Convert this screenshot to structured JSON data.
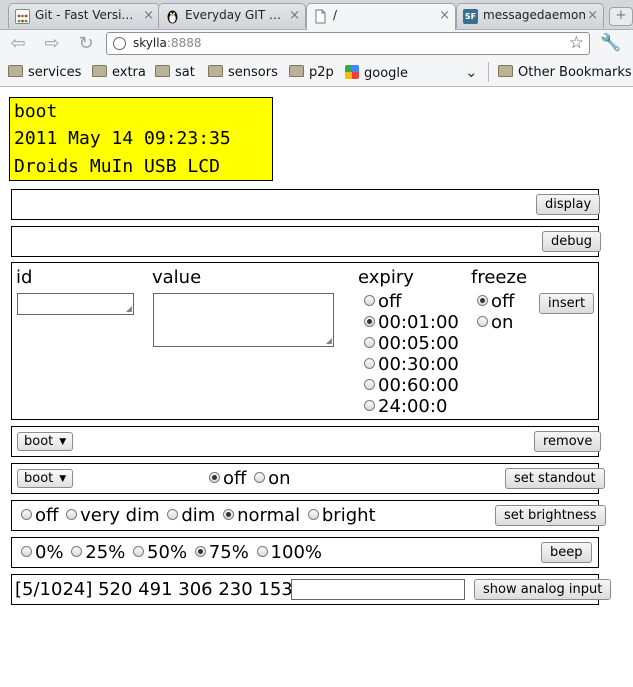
{
  "browser": {
    "tabs": [
      {
        "title": "Git - Fast Versi…",
        "active": false
      },
      {
        "title": "Everyday GIT …",
        "active": false
      },
      {
        "title": "/",
        "active": true
      },
      {
        "title": "messagedaemon",
        "active": false
      }
    ],
    "close_glyph": "×",
    "newtab_glyph": "+",
    "url_host": "skylla",
    "url_port": ":8888",
    "bookmarks": [
      "services",
      "extra",
      "sat",
      "sensors",
      "p2p",
      "google"
    ],
    "other_bookmarks": "Other Bookmarks"
  },
  "lcd": {
    "line1": "boot",
    "line2": "2011 May 14 09:23:35",
    "line3": "Droids MuIn USB LCD"
  },
  "display_form": {
    "button": "display"
  },
  "debug_form": {
    "button": "debug"
  },
  "insert_form": {
    "id_label": "id",
    "value_label": "value",
    "expiry_label": "expiry",
    "expiry_options": [
      "off",
      "00:01:00",
      "00:05:00",
      "00:30:00",
      "00:60:00",
      "24:00:0"
    ],
    "expiry_selected": "00:01:00",
    "freeze_label": "freeze",
    "freeze_options": [
      "off",
      "on"
    ],
    "freeze_selected": "off",
    "button": "insert"
  },
  "remove_form": {
    "select_value": "boot",
    "button": "remove"
  },
  "standout_form": {
    "select_value": "boot",
    "options": [
      "off",
      "on"
    ],
    "selected": "off",
    "button": "set standout"
  },
  "brightness_form": {
    "options": [
      "off",
      "very dim",
      "dim",
      "normal",
      "bright"
    ],
    "selected": "normal",
    "button": "set brightness"
  },
  "beep_form": {
    "options": [
      "0%",
      "25%",
      "50%",
      "75%",
      "100%"
    ],
    "selected": "75%",
    "button": "beep"
  },
  "analog_form": {
    "readout": "[5/1024] 520 491 306 230 153",
    "input_value": "",
    "button": "show analog input"
  }
}
